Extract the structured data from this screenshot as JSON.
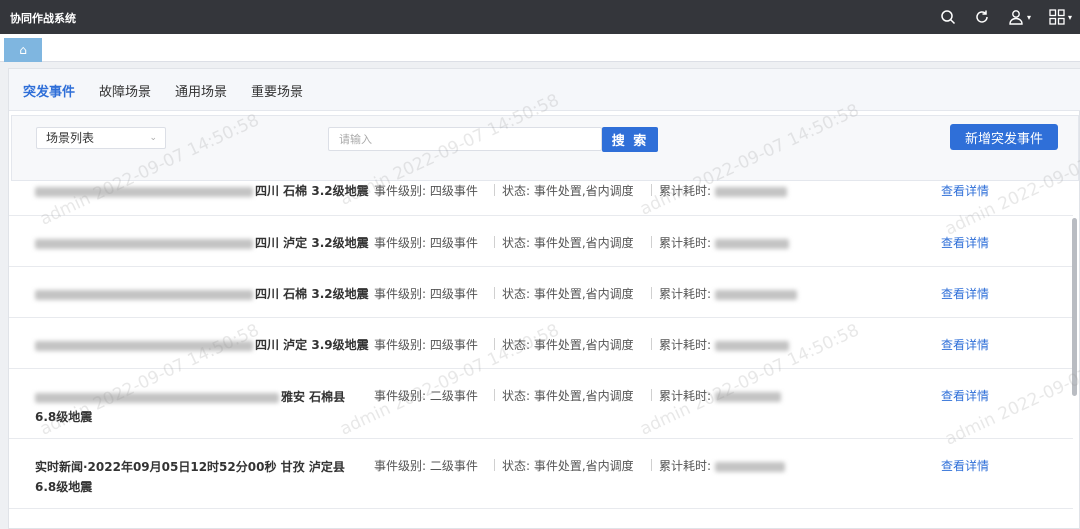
{
  "app": {
    "title": "协同作战系统"
  },
  "topbar": {
    "icons": [
      "search-icon",
      "refresh-icon",
      "user-icon",
      "apps-grid-icon"
    ],
    "caret": "▾"
  },
  "tabbar": {
    "home_icon": "⌂"
  },
  "tabs": [
    {
      "label": "突发事件",
      "active": true
    },
    {
      "label": "故障场景",
      "active": false
    },
    {
      "label": "通用场景",
      "active": false
    },
    {
      "label": "重要场景",
      "active": false
    }
  ],
  "filter": {
    "select_value": "场景列表",
    "search_placeholder": "请输入",
    "search_button": "搜 索",
    "add_button": "新增突发事件"
  },
  "rows": [
    {
      "title_prefix": "",
      "title": "四川 石棉 3.2级地震",
      "title2": "",
      "level": "事件级别: 四级事件",
      "status": "状态: 事件处置,省内调度",
      "elapsed": "累计耗时:",
      "detail": "查看详情"
    },
    {
      "title_prefix": "",
      "title": "四川 泸定 3.2级地震",
      "title2": "",
      "level": "事件级别: 四级事件",
      "status": "状态: 事件处置,省内调度",
      "elapsed": "累计耗时:",
      "detail": "查看详情"
    },
    {
      "title_prefix": "",
      "title": "四川 石棉 3.2级地震",
      "title2": "",
      "level": "事件级别: 四级事件",
      "status": "状态: 事件处置,省内调度",
      "elapsed": "累计耗时:",
      "detail": "查看详情"
    },
    {
      "title_prefix": "",
      "title": "四川 泸定 3.9级地震",
      "title2": "",
      "level": "事件级别: 四级事件",
      "status": "状态: 事件处置,省内调度",
      "elapsed": "累计耗时:",
      "detail": "查看详情"
    },
    {
      "title_prefix": "",
      "title": "雅安 石棉县",
      "title2": "6.8级地震",
      "level": "事件级别: 二级事件",
      "status": "状态: 事件处置,省内调度",
      "elapsed": "累计耗时:",
      "detail": "查看详情"
    },
    {
      "title_prefix": "实时新闻·2022年09月05日12时52分00秒",
      "title": "甘孜 泸定县",
      "title2": "6.8级地震",
      "level": "事件级别: 二级事件",
      "status": "状态: 事件处置,省内调度",
      "elapsed": "累计耗时:",
      "detail": "查看详情"
    }
  ],
  "watermark": "admin 2022-09-07 14:50:58"
}
